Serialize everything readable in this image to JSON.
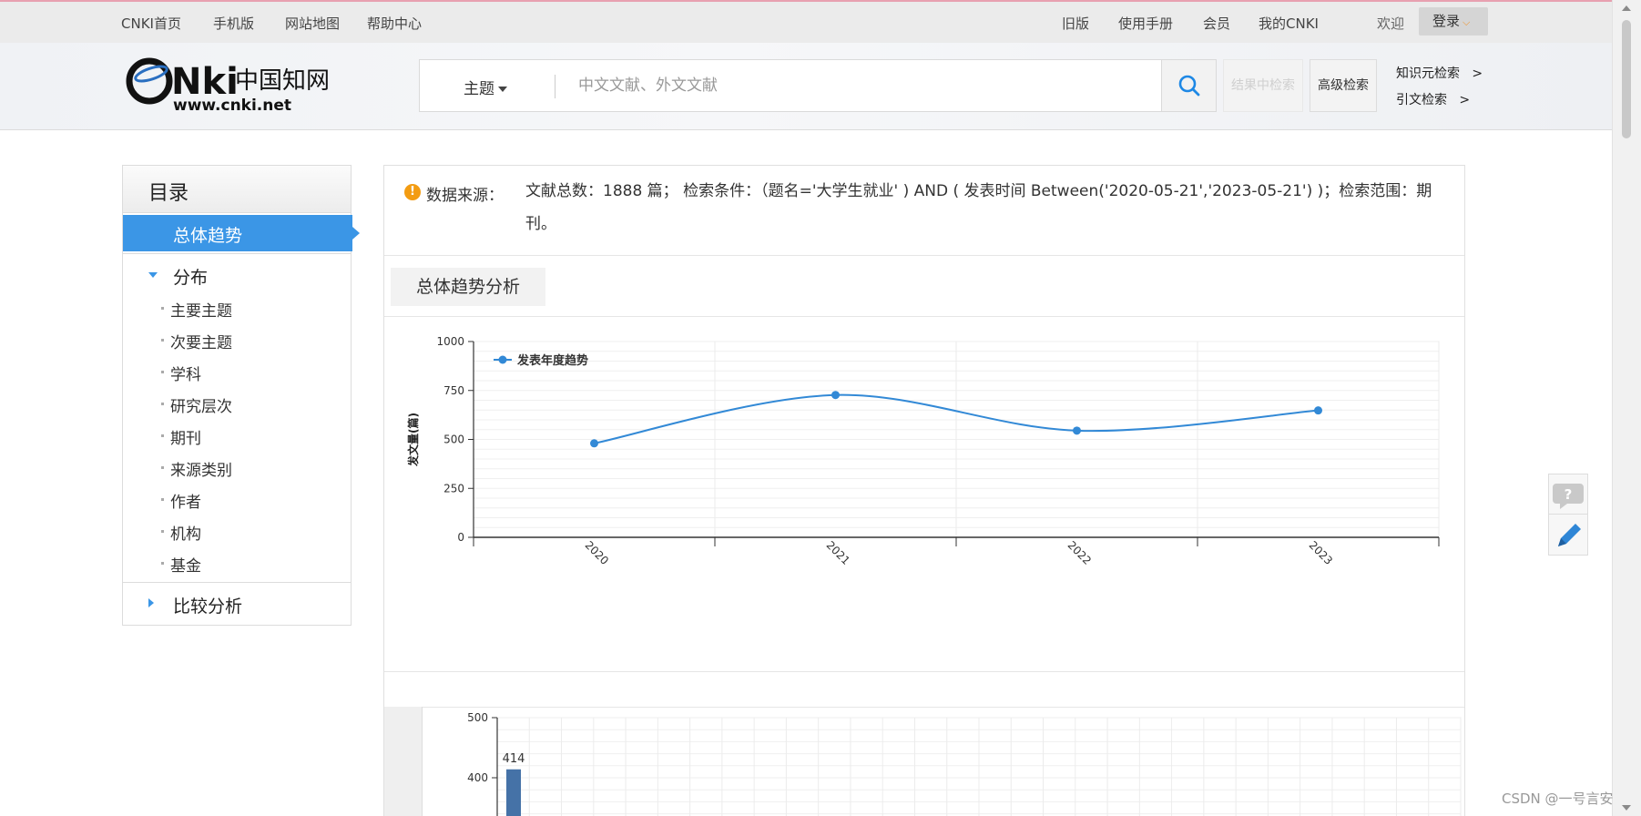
{
  "topnav": {
    "left": [
      "CNKI首页",
      "手机版",
      "网站地图",
      "帮助中心"
    ],
    "right": [
      "旧版",
      "使用手册",
      "会员",
      "我的CNKI"
    ],
    "welcome": "欢迎",
    "login": "登录"
  },
  "header": {
    "logo_text": "cnki中国知网",
    "logo_url": "www.cnki.net",
    "search_scope": "主题",
    "search_placeholder": "中文文献、外文文献",
    "btn_search_in_results": "结果中检索",
    "btn_advanced": "高级检索",
    "link_knowledge": "知识元检索",
    "link_citation": "引文检索",
    "arrow": ">"
  },
  "sidebar": {
    "title": "目录",
    "active": "总体趋势",
    "group_distribution": "分布",
    "sub_items": [
      "主要主题",
      "次要主题",
      "学科",
      "研究层次",
      "期刊",
      "来源类别",
      "作者",
      "机构",
      "基金"
    ],
    "group_compare": "比较分析"
  },
  "info": {
    "label": "数据来源：",
    "text": "文献总数：1888 篇；  检索条件：（题名='大学生就业' ) AND ( 发表时间 Between('2020-05-21','2023-05-21') )；检索范围：期刊。"
  },
  "section_tab": "总体趋势分析",
  "chart_data": [
    {
      "type": "line",
      "x": [
        "2020",
        "2021",
        "2022",
        "2023"
      ],
      "series": [
        {
          "name": "发表年度趋势",
          "values": [
            480,
            727,
            545,
            648
          ],
          "color": "#3289d6"
        }
      ],
      "ylabel": "发文量(篇)",
      "ylim": [
        0,
        1000
      ],
      "yticks": [
        "0",
        "250",
        "500",
        "750",
        "1000"
      ],
      "grid": true,
      "legend": "top-left",
      "smooth": true
    },
    {
      "type": "bar",
      "yticks": [
        "400",
        "500"
      ],
      "values": [
        414
      ],
      "data_labels": [
        "414"
      ],
      "color": "#4572a7",
      "grid": true
    }
  ],
  "watermark": "CSDN @一号言安"
}
